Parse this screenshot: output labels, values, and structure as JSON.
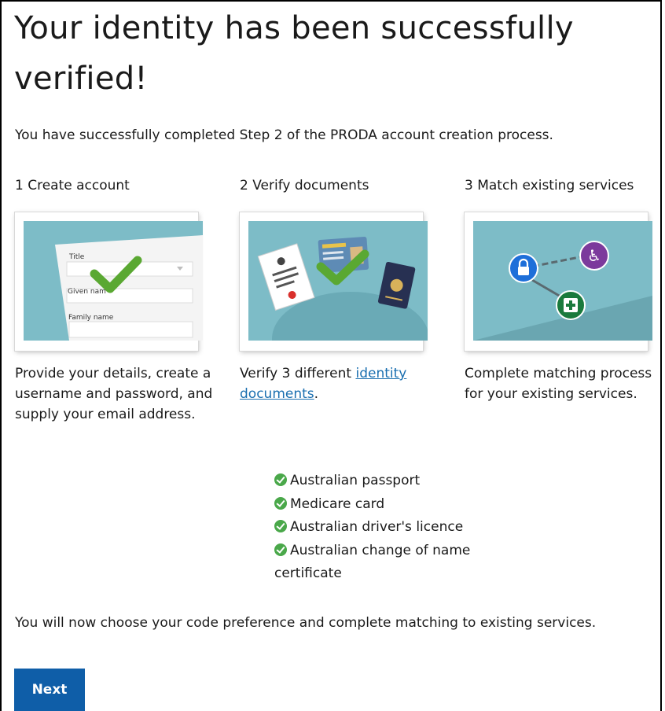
{
  "page": {
    "title": "Your identity has been successfully verified!",
    "intro": "You have successfully completed Step 2 of the PRODA account creation process.",
    "outro": "You will now choose your code preference and complete matching to existing services."
  },
  "steps": [
    {
      "heading": "1 Create account",
      "description": "Provide your details, create a username and password, and supply your email address.",
      "form_labels": {
        "title": "Title",
        "given_name": "Given nam",
        "family_name": "Family name"
      }
    },
    {
      "heading": "2 Verify documents",
      "description_before": "Verify 3 different ",
      "link_text": "identity documents",
      "description_after": "."
    },
    {
      "heading": "3 Match existing services",
      "description": "Complete matching process for your existing services."
    }
  ],
  "documents": [
    "Australian passport",
    "Medicare card",
    "Australian driver's licence",
    "Australian change of name certificate"
  ],
  "buttons": {
    "next": "Next"
  },
  "icons": {
    "check": "check-circle-icon",
    "lock": "lock-icon",
    "accessibility": "wheelchair-icon",
    "medical": "medical-cross-icon"
  },
  "colors": {
    "link": "#1a6fb0",
    "button": "#0f5ea8",
    "check": "#4aa84a",
    "illustration_bg": "#7dbcc7"
  }
}
